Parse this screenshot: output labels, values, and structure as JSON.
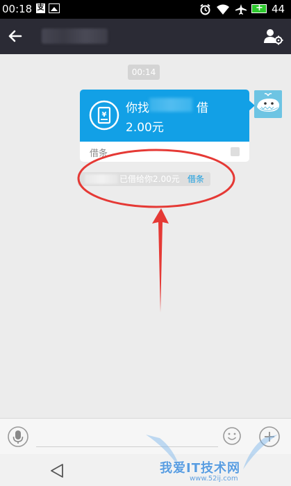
{
  "status_bar": {
    "time": "00:18",
    "notif_a_glyph": "支",
    "battery": "44",
    "icons": [
      "alarm-icon",
      "wifi-icon",
      "airplane-icon",
      "battery-icon"
    ]
  },
  "header": {
    "contact_name": ""
  },
  "chat": {
    "timestamp": "00:14",
    "loan_card": {
      "title": "你找　　　　借",
      "amount": "2.00元",
      "label": "借条"
    },
    "system_message": {
      "text": "已借给你2.00元",
      "link": "借条"
    }
  },
  "input_bar": {
    "placeholder": ""
  },
  "watermark": {
    "text": "我爱IT技术网",
    "url": "www.52ij.com"
  },
  "colors": {
    "accent": "#12a0e6",
    "header_bg": "#2b2b35",
    "annotation_red": "#e53935"
  }
}
